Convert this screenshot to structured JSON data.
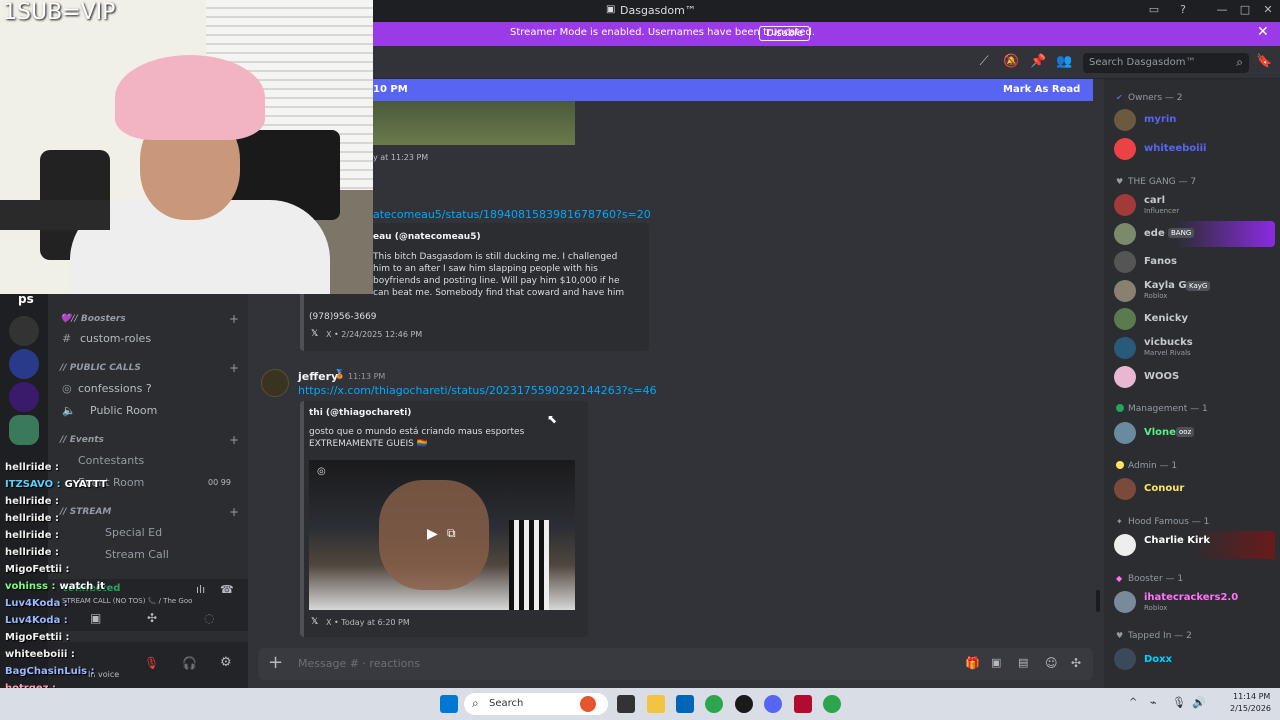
{
  "overlay": {
    "sub_text": "1SUB=VIP"
  },
  "window": {
    "title": "Dasgasdom™"
  },
  "banner": {
    "message": "Streamer Mode is enabled. Usernames have been truncated.",
    "disable_label": "Disable"
  },
  "header": {
    "search_placeholder": "Search Dasgasdom™"
  },
  "unread": {
    "left_text": "10 PM",
    "mark_read": "Mark As Read"
  },
  "chat": {
    "top_timestamp": "y at 11:23 PM",
    "link1": "atecomeau5/status/1894081583981678760?s=20",
    "embed1": {
      "author": "eau (@natecomeau5)",
      "body": "This bitch Dasgasdom is still ducking me. I challenged him to an after I saw him slapping people with his boyfriends and posting line. Will pay him $10,000 if he can beat me. Somebody find that coward and have him call me up.",
      "phone": "(978)956-3669",
      "footer": "X • 2/24/2025 12:46 PM"
    },
    "msg2": {
      "username": "jeffery",
      "time": "11:13 PM",
      "link": "https://x.com/thiagochareti/status/2023175590292144263?s=46",
      "embed_author": "thi (@thiagochareti)",
      "embed_body": "gosto que o mundo está criando maus esportes EXTREMAMENTE GUEIS 🏳️‍🌈",
      "footer": "X • Today at 6:20 PM"
    }
  },
  "composer": {
    "placeholder": "Message # · reactions"
  },
  "sidebar": {
    "server_name": "ps",
    "boosters_cat": "💜// Boosters",
    "custom_roles": "custom-roles",
    "public_calls_cat": "// PUBLIC CALLS",
    "confessions": "confessions ?",
    "public_room": "Public Room",
    "events_cat": "// Events",
    "contestants": "Contestants",
    "event_room": "Event Room",
    "event_counts": "00  99",
    "stream_cat": "// STREAM",
    "special_ed": "Special Ed",
    "stream_call": "Stream Call",
    "voice_status": "connected",
    "voice_channel": "STREAM CALL (NO TOS) 📞 / The Goon...",
    "user_status": "In voice"
  },
  "live_chat": [
    {
      "user": "hellriide :",
      "text": "",
      "color": "#f0f0f0"
    },
    {
      "user": "ITZSAVO :",
      "text": "GYATTT",
      "color": "#5bd0ff"
    },
    {
      "user": "hellriide :",
      "text": "",
      "color": "#f0f0f0"
    },
    {
      "user": "hellriide :",
      "text": "",
      "color": "#f0f0f0"
    },
    {
      "user": "hellriide :",
      "text": "",
      "color": "#f0f0f0"
    },
    {
      "user": "hellriide :",
      "text": "",
      "color": "#f0f0f0"
    },
    {
      "user": "MigoFettii :",
      "text": "",
      "color": "#f0f0f0"
    },
    {
      "user": "vohinss :",
      "text": "watch it",
      "color": "#7dff7d"
    },
    {
      "user": "Luv4Koda :",
      "text": "",
      "color": "#9ab8ff"
    },
    {
      "user": "Luv4Koda :",
      "text": "",
      "color": "#9ab8ff"
    },
    {
      "user": "MigoFettii :",
      "text": "",
      "color": "#f0f0f0"
    },
    {
      "user": "whiteeboiii :",
      "text": "",
      "color": "#f0f0f0"
    },
    {
      "user": "BagChasinLuis :",
      "text": "",
      "color": "#9ab8ff"
    },
    {
      "user": "hotrgez :",
      "text": "",
      "color": "#ff9ab8"
    },
    {
      "user": "MigoFettii :",
      "text": "",
      "color": "#f0f0f0"
    }
  ],
  "members": {
    "owners_head": "Owners — 2",
    "owner1": "myrin",
    "owner2": "whiteeboiii",
    "gang_head": "THE GANG — 7",
    "carl": "carl",
    "carl_sub": "Influencer",
    "ede": "ede",
    "ede_tag": "BANG",
    "fanos": "Fanos",
    "kayla": "Kayla G",
    "kayla_tag": "KayG",
    "kayla_sub": "Roblox",
    "kenicky": "Kenicky",
    "vicbucks": "vicbucks",
    "vicbucks_sub": "Marvel Rivals",
    "woos": "WOOS",
    "mgmt_head": "Management — 1",
    "vlone": "Vlone",
    "vlone_tag": "ooz",
    "admin_head": "Admin — 1",
    "conour": "Conour",
    "hood_head": "Hood Famous — 1",
    "charlie": "Charlie Kirk",
    "booster_head": "Booster — 1",
    "ihate": "ihatecrackers2.0",
    "ihate_sub": "Roblox",
    "tapped_head": "Tapped In — 2",
    "doxx": "Doxx"
  },
  "taskbar": {
    "search_label": "Search",
    "time": "11:14 PM",
    "date": "2/15/2026"
  },
  "colors": {
    "accent": "#5865f2",
    "banner": "#9b3be8",
    "link": "#00a8fc"
  }
}
